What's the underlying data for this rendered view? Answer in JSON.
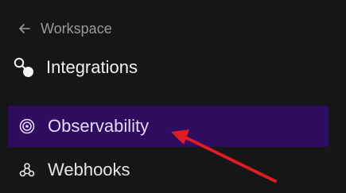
{
  "nav": {
    "back_label": "Workspace",
    "section_title": "Integrations",
    "items": [
      {
        "label": "Observability",
        "icon": "radar-icon",
        "active": true
      },
      {
        "label": "Webhooks",
        "icon": "webhook-icon",
        "active": false
      }
    ]
  },
  "colors": {
    "background": "#161616",
    "active_bg": "#2e0c5e",
    "annotation_arrow": "#e01b22"
  }
}
